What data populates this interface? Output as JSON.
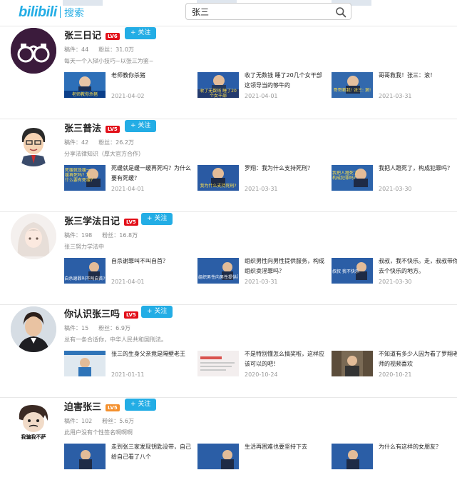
{
  "header": {
    "logo_text": "bilibili",
    "section_title": "搜索",
    "search_value": "张三"
  },
  "users": [
    {
      "name": "张三日记",
      "level": "LV6",
      "follow_label": "+ 关注",
      "videos_label": "稿件：44",
      "fans_label": "粉丝：31.0万",
      "desc": "每天一个入狱小技巧~以张三为鉴~",
      "videos": [
        {
          "title": "老师教你杀猪",
          "date": "2021-04-02",
          "thumb_text": "老师教你杀猪"
        },
        {
          "title": "收了无数钱 睡了20几个女干部 这领导当的够牛的",
          "date": "2021-04-01",
          "thumb_text": "收了无数钱 睡了20个女干部"
        },
        {
          "title": "哥哥救我！张三：滚！",
          "date": "2021-03-31",
          "thumb_text": "哥哥救我! 张三: 滚!"
        }
      ]
    },
    {
      "name": "张三普法",
      "level": "LV5",
      "follow_label": "+ 关注",
      "videos_label": "稿件：42",
      "fans_label": "粉丝：26.2万",
      "desc": "分享法律知识（厚大官方合作）",
      "videos": [
        {
          "title": "死缓就是缓一缓再死吗？为什么要有死缓？",
          "date": "2021-04-01",
          "thumb_text": "死缓就是缓一缓再死吗? 为什么要有死缓?"
        },
        {
          "title": "罗翔：我为什么支持死刑？",
          "date": "2021-03-31",
          "thumb_text": "我为什么支持死刑?"
        },
        {
          "title": "我把人蹬死了，构成犯罪吗？",
          "date": "2021-03-30",
          "thumb_text": "我把人蹬死了 构成犯罪吗?"
        }
      ]
    },
    {
      "name": "张三学法日记",
      "level": "LV5",
      "follow_label": "+ 关注",
      "videos_label": "稿件：198",
      "fans_label": "粉丝：16.8万",
      "desc": "张三努力学法中",
      "videos": [
        {
          "title": "自杀谢罪叫不叫自首？",
          "date": "2021-04-01",
          "thumb_text": "自杀谢罪叫不叫自首?"
        },
        {
          "title": "组织男性向男性提供服务，构成组织卖淫罪吗？",
          "date": "2021-03-31",
          "thumb_text": "组织男性向男性提供服务"
        },
        {
          "title": "叔叔，我不快乐。走，叔叔带你去个快乐的地方。",
          "date": "2021-03-30",
          "thumb_text": "叔叔 我不快乐"
        }
      ]
    },
    {
      "name": "你认识张三吗",
      "level": "LV5",
      "follow_label": "+ 关注",
      "videos_label": "稿件：15",
      "fans_label": "粉丝：6.9万",
      "desc": "总有一条合适你，中华人民共和国刑法。",
      "videos": [
        {
          "title": "张三的生身父亲竟是隔壁老王",
          "date": "2021-01-11",
          "thumb_text": ""
        },
        {
          "title": "不是特别懂怎么搞奖啦，这样应该可以的吧！",
          "date": "2020-10-24",
          "thumb_text": ""
        },
        {
          "title": "不知道有多少人因为看了罗翔老师的视频喜欢",
          "date": "2020-10-21",
          "thumb_text": ""
        }
      ]
    },
    {
      "name": "迫害张三",
      "level": "LV5",
      "follow_label": "+ 关注",
      "videos_label": "稿件：102",
      "fans_label": "粉丝：5.6万",
      "desc": "此用户没有个性签名啊啊啊",
      "videos": [
        {
          "title": "走到张三家发现钥匙没带，自己给自己看了八个",
          "date": "",
          "thumb_text": ""
        },
        {
          "title": "生活再困难也要坚持下去",
          "date": "",
          "thumb_text": ""
        },
        {
          "title": "为什么有这样的女朋友？",
          "date": "",
          "thumb_text": ""
        }
      ]
    }
  ],
  "avatar4_text": "我骗我不萨",
  "colors": {
    "brand": "#23ade5",
    "level_red": "#e20f19",
    "level_orange": "#f4902d"
  }
}
